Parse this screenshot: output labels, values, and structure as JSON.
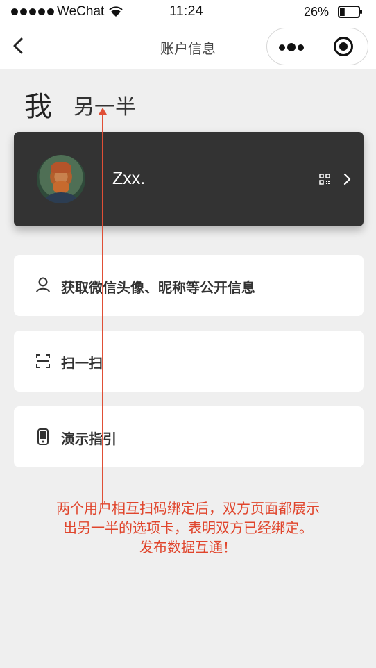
{
  "status_bar": {
    "carrier": "WeChat",
    "time": "11:24",
    "battery_percent": "26%",
    "battery_level": 0.26
  },
  "nav": {
    "title": "账户信息",
    "back_icon": "chevron-left-icon",
    "more_icon": "more-dots-icon",
    "close_icon": "target-close-icon"
  },
  "tabs": {
    "me": "我",
    "partner": "另一半"
  },
  "profile": {
    "name": "Zxx.",
    "qr_icon": "qr-code-icon",
    "arrow_icon": "chevron-right-icon"
  },
  "menu": [
    {
      "label": "获取微信头像、昵称等公开信息",
      "icon": "user-icon"
    },
    {
      "label": "扫一扫",
      "icon": "scan-icon"
    },
    {
      "label": "演示指引",
      "icon": "phone-icon"
    }
  ],
  "annotation": {
    "line1": "两个用户相互扫码绑定后，双方页面都展示",
    "line2": "出另一半的选项卡，表明双方已经绑定。",
    "line3": "发布数据互通！",
    "color": "#e0452c"
  },
  "colors": {
    "background": "#efefef",
    "card_dark": "#333333",
    "card_light": "#ffffff"
  }
}
